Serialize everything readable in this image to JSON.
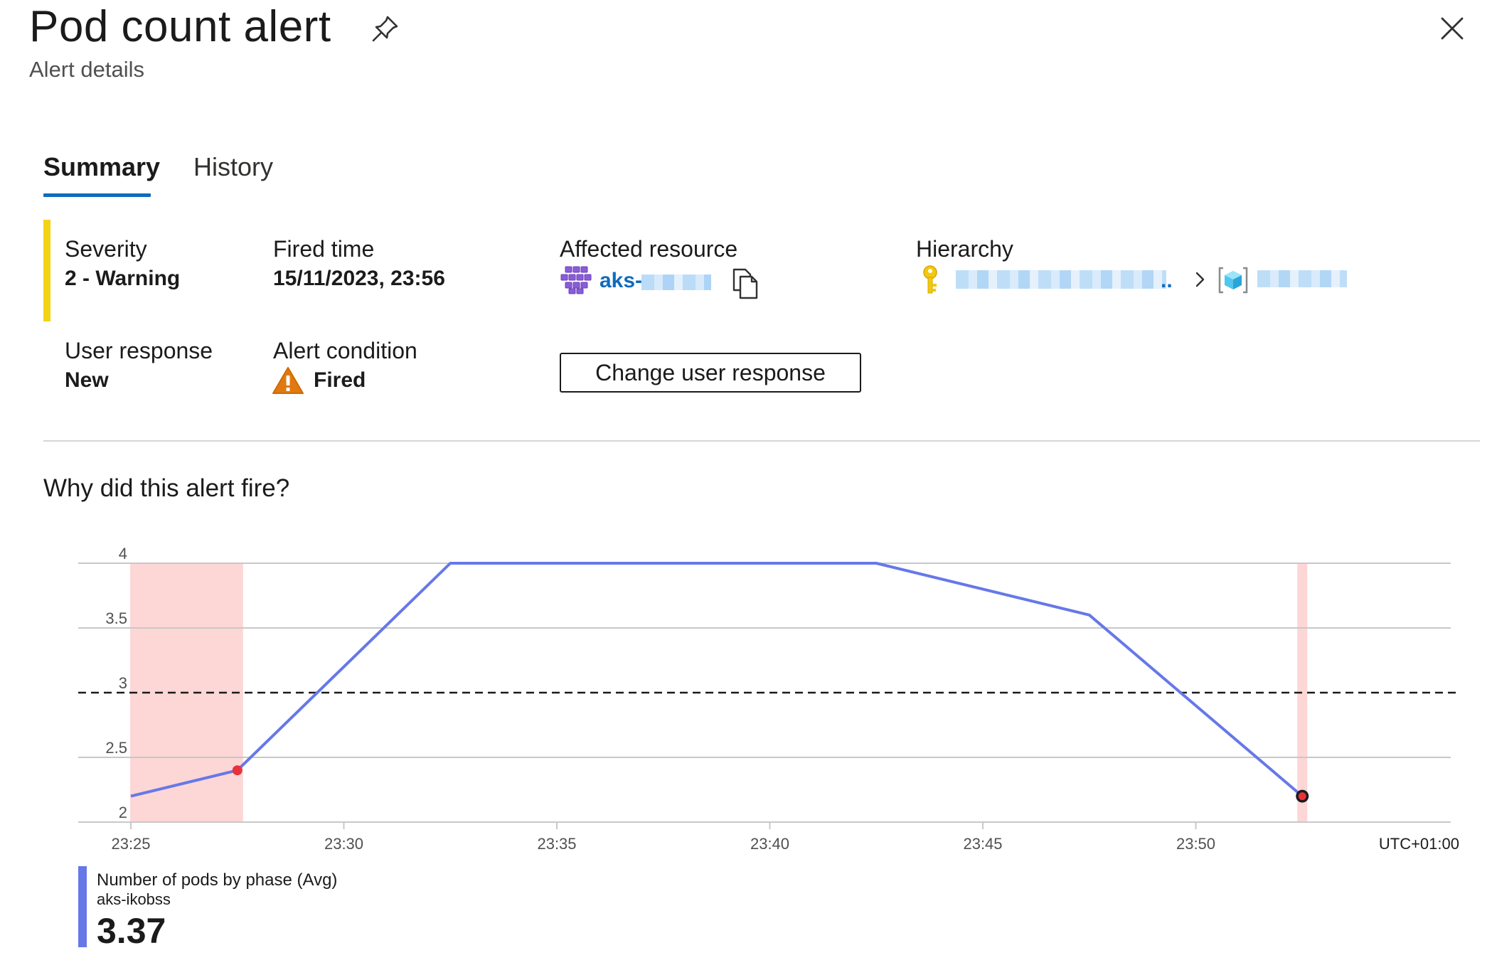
{
  "header": {
    "title": "Pod count alert",
    "subtitle": "Alert details",
    "pin_icon": "pin-icon",
    "close_icon": "close-icon"
  },
  "tabs": [
    {
      "label": "Summary",
      "selected": true
    },
    {
      "label": "History",
      "selected": false
    }
  ],
  "summary": {
    "severity": {
      "label": "Severity",
      "value": "2 - Warning",
      "color": "#f3d316"
    },
    "fired_time": {
      "label": "Fired time",
      "value": "15/11/2023, 23:56"
    },
    "affected_resource": {
      "label": "Affected resource",
      "link_text": "aks-",
      "icon": "aks-cluster-icon",
      "copy_icon": "copy-icon"
    },
    "hierarchy": {
      "label": "Hierarchy",
      "subscription_icon": "key-icon",
      "ellipsis": "..",
      "separator_icon": "chevron-right-icon",
      "resource_group_icon": "resource-group-icon"
    },
    "user_response": {
      "label": "User response",
      "value": "New"
    },
    "alert_condition": {
      "label": "Alert condition",
      "value": "Fired",
      "icon": "warning-icon"
    },
    "change_button_label": "Change user response"
  },
  "why_section": {
    "title": "Why did this alert fire?"
  },
  "chart_data": {
    "type": "line",
    "x_labels": [
      "23:25",
      "23:30",
      "23:35",
      "23:40",
      "23:45",
      "23:50"
    ],
    "timezone_label": "UTC+01:00",
    "y_ticks": [
      "2",
      "2.5",
      "3",
      "3.5",
      "4"
    ],
    "ylim": [
      2,
      4
    ],
    "threshold": 3,
    "series": [
      {
        "name": "Number of pods by phase (Avg)",
        "color": "#6678e8",
        "x": [
          "23:25",
          "23:27:30",
          "23:32:30",
          "23:42:30",
          "23:47:30",
          "23:52:30"
        ],
        "values": [
          2.2,
          2.4,
          4,
          4,
          3.6,
          2.2
        ]
      }
    ],
    "fired_markers": [
      "23:27:30",
      "23:52:30"
    ],
    "highlight_color": "#fdd6d6",
    "grid": true
  },
  "legend": {
    "series_name": "Number of pods by phase (Avg)",
    "resource": "aks-ikobss",
    "value": "3.37"
  }
}
